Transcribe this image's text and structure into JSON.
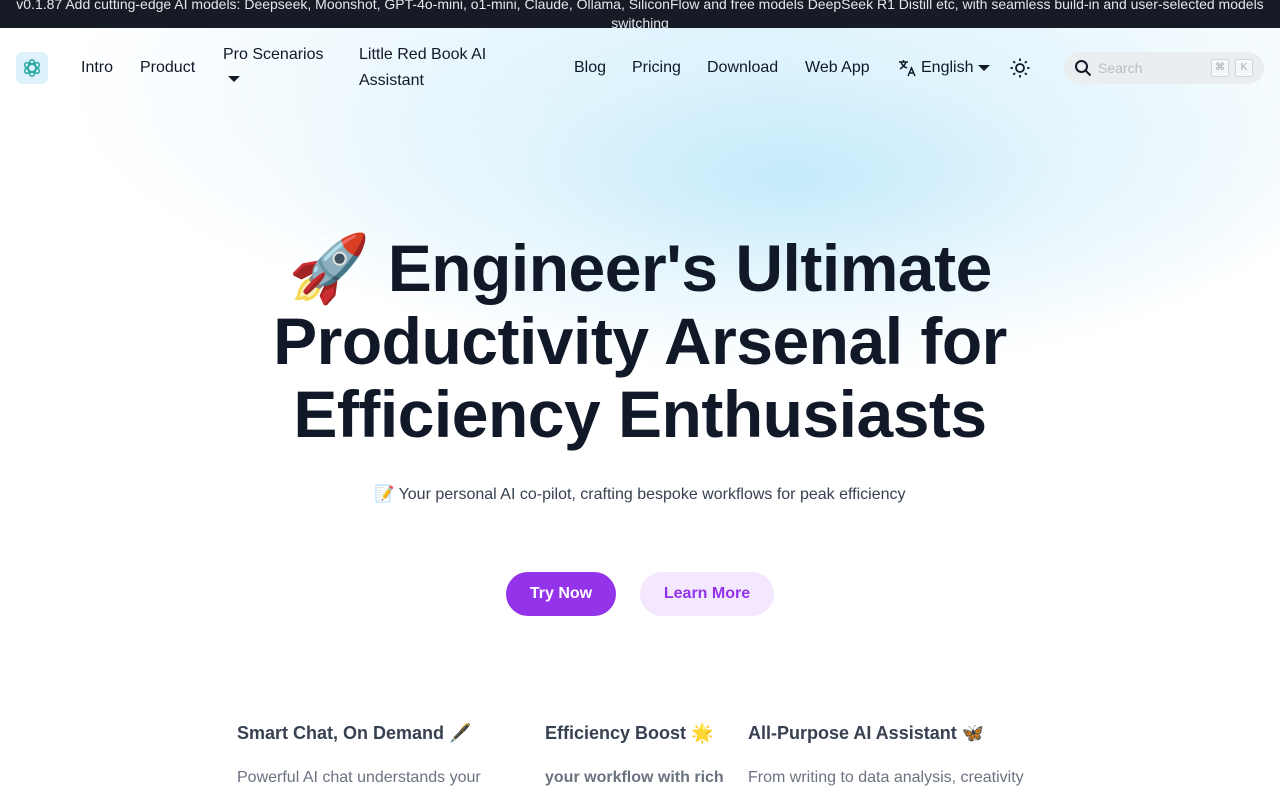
{
  "banner": {
    "text": "v0.1.87 Add cutting-edge AI models: Deepseek, Moonshot, GPT-4o-mini, o1-mini, Claude, Ollama, SiliconFlow and free models DeepSeek R1 Distill etc, with seamless build-in and user-selected models switching"
  },
  "nav": {
    "logo": "openai-logo",
    "items": [
      {
        "label": "Intro"
      },
      {
        "label": "Product"
      },
      {
        "label": "Pro Scenarios"
      },
      {
        "label": "Little Red Book AI Assistant"
      },
      {
        "label": "Blog"
      },
      {
        "label": "Pricing"
      },
      {
        "label": "Download"
      },
      {
        "label": "Web App"
      }
    ],
    "language": "English",
    "search": {
      "placeholder": "Search",
      "shortcut_mod": "⌘",
      "shortcut_key": "K"
    }
  },
  "hero": {
    "emoji": "🚀",
    "title_line1": "Engineer's Ultimate",
    "title_line2": "Productivity Arsenal for",
    "title_line3": "Efficiency Enthusiasts",
    "subtitle_emoji": "📝",
    "subtitle": "Your personal AI co-pilot, crafting bespoke workflows for peak efficiency",
    "primary_button": "Try Now",
    "secondary_button": "Learn More"
  },
  "features": [
    {
      "title": "Smart Chat, On Demand",
      "emoji": "🖋️",
      "text": "Powerful AI chat understands your"
    },
    {
      "title": "Efficiency Boost",
      "emoji": "🌟",
      "text": "your workflow with rich"
    },
    {
      "title": "All-Purpose AI Assistant",
      "emoji": "🦋",
      "text": "From writing to data analysis, creativity"
    }
  ],
  "colors": {
    "accent": "#9333ea",
    "accent_light": "#f3e8fd",
    "banner_bg": "#161b26"
  }
}
